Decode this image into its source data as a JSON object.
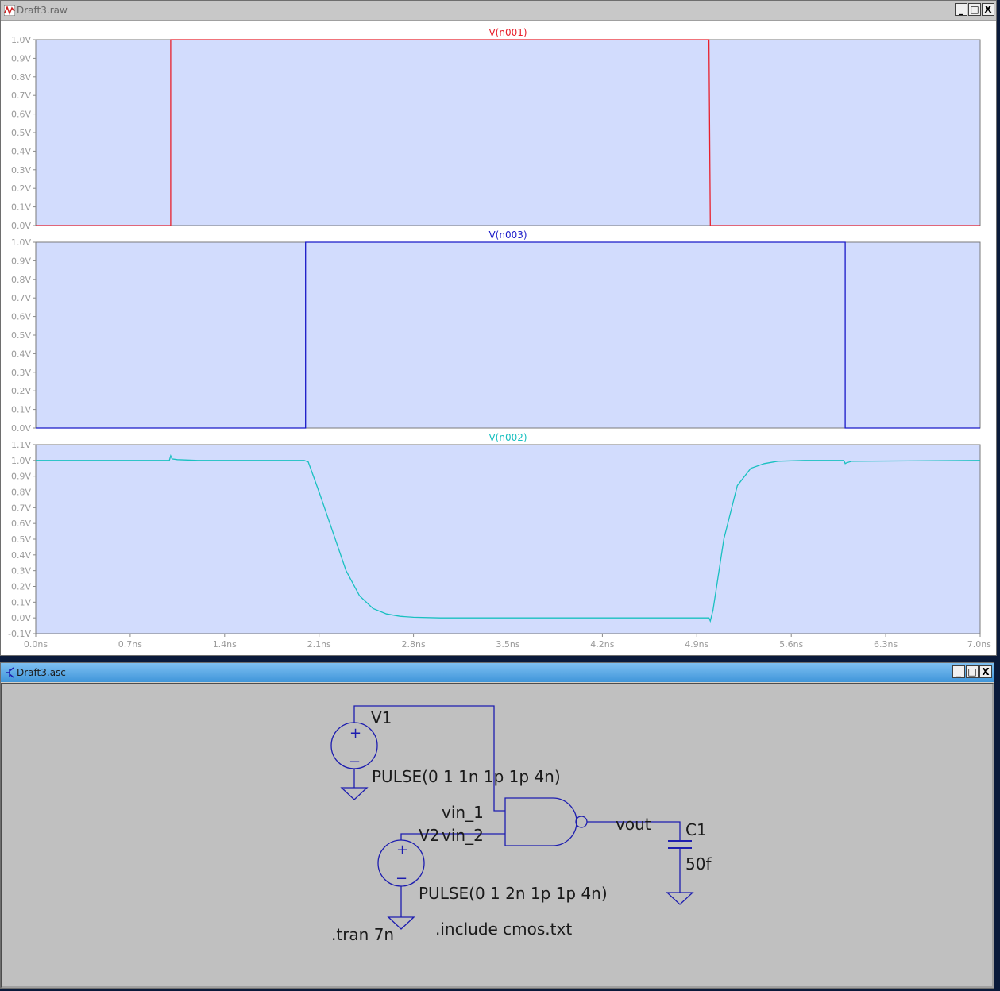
{
  "waveform_window": {
    "title": "Draft3.raw",
    "controls": [
      "_",
      "□",
      "X"
    ]
  },
  "schematic_window": {
    "title": "Draft3.asc",
    "controls": [
      "_",
      "□",
      "X"
    ]
  },
  "colors": {
    "plot_bg": "#d2dcfd",
    "trace_n001": "#e8202c",
    "trace_n003": "#1a1ac8",
    "trace_n002": "#19c0c0",
    "wire": "#1d1daf",
    "axis_text": "#9a9a9a"
  },
  "chart_data": [
    {
      "type": "line",
      "title": "V(n001)",
      "xlabel": "",
      "ylabel": "",
      "xlim": [
        0,
        7.0
      ],
      "ylim": [
        0,
        1.0
      ],
      "yticks": [
        0.0,
        0.1,
        0.2,
        0.3,
        0.4,
        0.5,
        0.6,
        0.7,
        0.8,
        0.9,
        1.0
      ],
      "ytick_labels": [
        "0.0V",
        "0.1V",
        "0.2V",
        "0.3V",
        "0.4V",
        "0.5V",
        "0.6V",
        "0.7V",
        "0.8V",
        "0.9V",
        "1.0V"
      ],
      "series": [
        {
          "name": "V(n001)",
          "x_ns": [
            0,
            1.0,
            1.0,
            4.99,
            5.0,
            7.0
          ],
          "y": [
            0,
            0,
            1.0,
            1.0,
            0,
            0
          ]
        }
      ]
    },
    {
      "type": "line",
      "title": "V(n003)",
      "xlabel": "",
      "ylabel": "",
      "xlim": [
        0,
        7.0
      ],
      "ylim": [
        0,
        1.0
      ],
      "yticks": [
        0.0,
        0.1,
        0.2,
        0.3,
        0.4,
        0.5,
        0.6,
        0.7,
        0.8,
        0.9,
        1.0
      ],
      "ytick_labels": [
        "0.0V",
        "0.1V",
        "0.2V",
        "0.3V",
        "0.4V",
        "0.5V",
        "0.6V",
        "0.7V",
        "0.8V",
        "0.9V",
        "1.0V"
      ],
      "series": [
        {
          "name": "V(n003)",
          "x_ns": [
            0,
            2.0,
            2.0,
            6.0,
            6.0,
            7.0
          ],
          "y": [
            0,
            0,
            1.0,
            1.0,
            0,
            0
          ]
        }
      ]
    },
    {
      "type": "line",
      "title": "V(n002)",
      "xlabel": "",
      "ylabel": "",
      "xlim": [
        0,
        7.0
      ],
      "ylim": [
        -0.1,
        1.1
      ],
      "yticks": [
        -0.1,
        0.0,
        0.1,
        0.2,
        0.3,
        0.4,
        0.5,
        0.6,
        0.7,
        0.8,
        0.9,
        1.0,
        1.1
      ],
      "ytick_labels": [
        "-0.1V",
        "0.0V",
        "0.1V",
        "0.2V",
        "0.3V",
        "0.4V",
        "0.5V",
        "0.6V",
        "0.7V",
        "0.8V",
        "0.9V",
        "1.0V",
        "1.1V"
      ],
      "xticks": [
        0,
        0.7,
        1.4,
        2.1,
        2.8,
        3.5,
        4.2,
        4.9,
        5.6,
        6.3,
        7.0
      ],
      "xtick_labels": [
        "0.0ns",
        "0.7ns",
        "1.4ns",
        "2.1ns",
        "2.8ns",
        "3.5ns",
        "4.2ns",
        "4.9ns",
        "5.6ns",
        "6.3ns",
        "7.0ns"
      ],
      "series": [
        {
          "name": "V(n002)",
          "x_ns": [
            0,
            0.99,
            1.0,
            1.01,
            1.05,
            1.2,
            1.99,
            2.02,
            2.1,
            2.2,
            2.3,
            2.4,
            2.5,
            2.6,
            2.7,
            2.8,
            3.0,
            4.0,
            4.99,
            5.0,
            5.02,
            5.1,
            5.2,
            5.3,
            5.4,
            5.5,
            5.7,
            5.99,
            6.0,
            6.01,
            6.05,
            7.0
          ],
          "y": [
            1.0,
            1.0,
            1.03,
            1.01,
            1.005,
            1.0,
            1.0,
            0.99,
            0.8,
            0.55,
            0.3,
            0.14,
            0.06,
            0.025,
            0.01,
            0.004,
            0.0,
            0.0,
            0.0,
            -0.02,
            0.05,
            0.5,
            0.84,
            0.95,
            0.98,
            0.995,
            1.0,
            1.0,
            0.98,
            0.985,
            0.995,
            1.0
          ]
        }
      ]
    }
  ],
  "schematic": {
    "labels": {
      "v1_name": "V1",
      "v1_value": "PULSE(0 1 1n 1p 1p 4n)",
      "v2_name": "V2",
      "v2_value": "PULSE(0 1 2n 1p 1p 4n)",
      "net_vin1": "vin_1",
      "net_vin2": "vin_2",
      "net_vout": "vout",
      "c1_name": "C1",
      "c1_value": "50f",
      "directive_tran": ".tran 7n",
      "directive_include": ".include cmos.txt",
      "plus": "+",
      "minus": "−"
    }
  }
}
